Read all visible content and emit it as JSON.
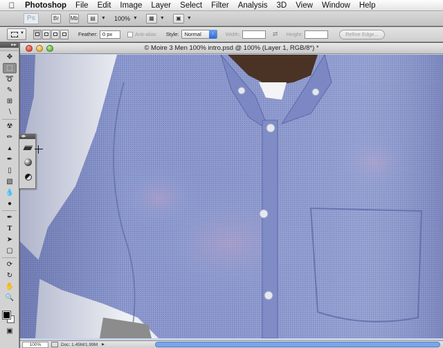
{
  "menubar": {
    "app_name": "Photoshop",
    "items": [
      "File",
      "Edit",
      "Image",
      "Layer",
      "Select",
      "Filter",
      "Analysis",
      "3D",
      "View",
      "Window",
      "Help"
    ]
  },
  "appbar": {
    "logo": "Ps",
    "bridge_label": "Br",
    "minibridge_label": "Mb",
    "zoom_value": "100%"
  },
  "options": {
    "feather_label": "Feather:",
    "feather_value": "0 px",
    "antialias_label": "Anti-alias",
    "style_label": "Style:",
    "style_value": "Normal",
    "width_label": "Width:",
    "width_value": "",
    "height_label": "Height:",
    "height_value": "",
    "refine_edge_label": "Refine Edge..."
  },
  "document": {
    "title": "© Moire 3 Men 100%  intro.psd @ 100% (Layer 1, RGB/8*) *"
  },
  "statusbar": {
    "zoom": "100%",
    "doc_info": "Doc: 1.45M/1.99M"
  },
  "colors": {
    "shirt": "#8290c8",
    "background": "#eef0f4",
    "skin": "#4a3324",
    "foreground_swatch": "#000000",
    "background_swatch": "#ffffff"
  }
}
